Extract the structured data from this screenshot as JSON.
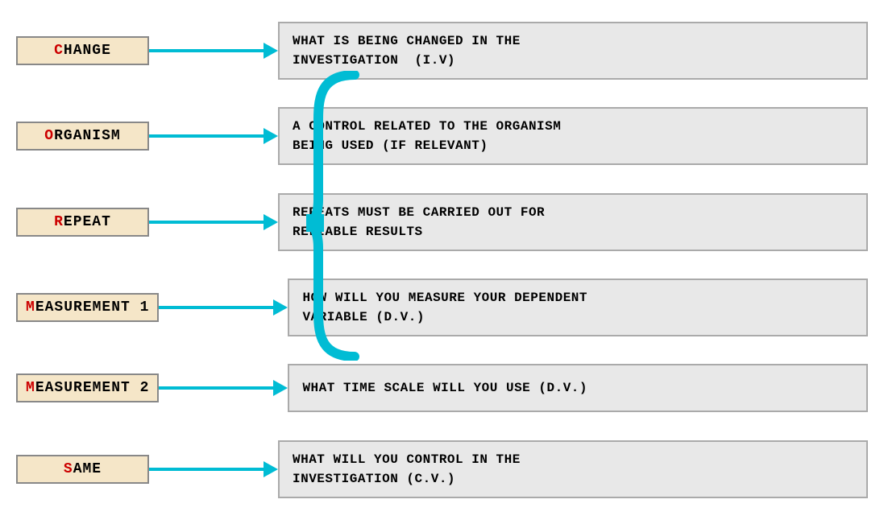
{
  "rows": [
    {
      "id": "change",
      "label_prefix": "C",
      "label_rest": "HANGE",
      "description": "WHAT IS BEING CHANGED IN THE\nINVESTIGATION  (I.V)",
      "has_bracket": false
    },
    {
      "id": "organism",
      "label_prefix": "O",
      "label_rest": "RGANISM",
      "description": "A CONTROL RELATED TO THE ORGANISM\nBEING USED (IF RELEVANT)",
      "has_bracket": false
    },
    {
      "id": "repeat",
      "label_prefix": "R",
      "label_rest": "EPEAT",
      "description": "REPEATS MUST BE CARRIED OUT FOR\nRELIABLE RESULTS",
      "has_bracket": true
    },
    {
      "id": "measurement1",
      "label_prefix": "M",
      "label_rest": "EASUREMENT 1",
      "description": "HOW WILL YOU MEASURE YOUR DEPENDENT\nVARIABLE (D.V.)",
      "has_bracket": true
    },
    {
      "id": "measurement2",
      "label_prefix": "M",
      "label_rest": "EASUREMENT 2",
      "description": "WHAT TIME SCALE WILL YOU USE (D.V.)",
      "has_bracket": true
    },
    {
      "id": "same",
      "label_prefix": "S",
      "label_rest": "AME",
      "description": "WHAT WILL YOU CONTROL IN THE\nINVESTIGATION (C.V.)",
      "has_bracket": false
    }
  ]
}
